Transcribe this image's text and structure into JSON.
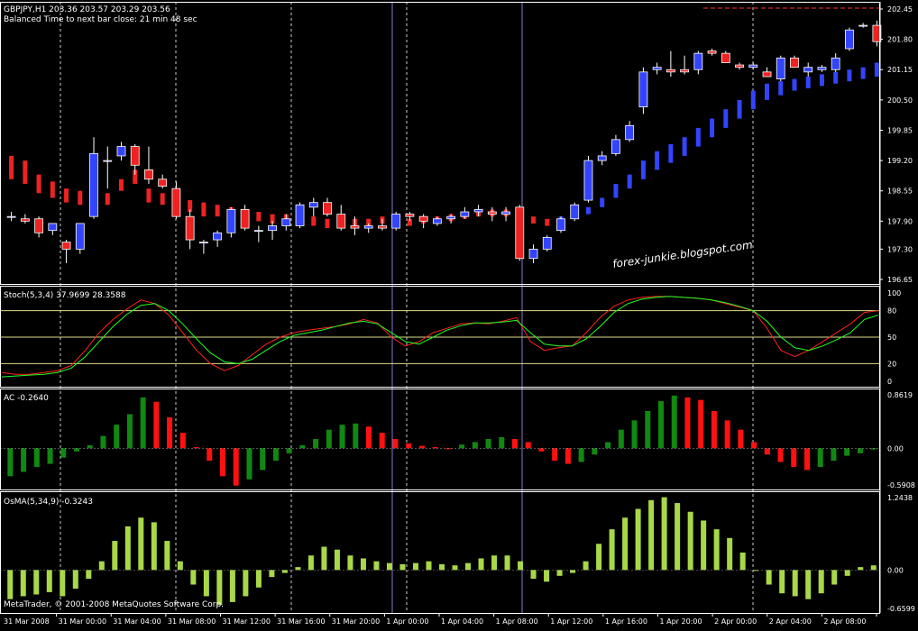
{
  "header": {
    "symbol_line": "GBPJPY,H1  203.36 203.57 203.29 203.56",
    "timer_line": "Balanced Time to next bar close: 21 min 48 sec"
  },
  "watermark": "forex-junkie.blogspot.com",
  "footer": "MetaTrader, © 2001-2008 MetaQuotes Software Corp.",
  "colors": {
    "background": "#000000",
    "axis": "#ffffff",
    "bull": "#3344ff",
    "bear": "#ee2222",
    "ac_up": "#118811",
    "ac_down": "#ff1111",
    "osma": "#a8d848",
    "stoch_main": "#ff2020",
    "stoch_signal": "#20ff20"
  },
  "chart_data": [
    {
      "type": "candlestick",
      "name": "price",
      "ylim": [
        196.65,
        202.45
      ],
      "y_ticks": [
        "202.45",
        "201.80",
        "201.15",
        "200.50",
        "199.85",
        "199.20",
        "198.55",
        "197.90",
        "197.30",
        "196.65"
      ],
      "candles": [
        [
          198.0,
          198.1,
          197.9,
          198.0
        ],
        [
          197.95,
          198.05,
          197.85,
          197.9
        ],
        [
          197.95,
          198.0,
          197.55,
          197.65
        ],
        [
          197.7,
          197.85,
          197.6,
          197.85
        ],
        [
          197.45,
          197.5,
          197.0,
          197.3
        ],
        [
          197.3,
          197.85,
          197.2,
          197.85
        ],
        [
          198.0,
          199.7,
          197.95,
          199.35
        ],
        [
          199.2,
          199.5,
          198.6,
          199.2
        ],
        [
          199.3,
          199.6,
          199.2,
          199.5
        ],
        [
          199.5,
          199.55,
          198.9,
          199.1
        ],
        [
          199.0,
          199.5,
          198.7,
          198.8
        ],
        [
          198.8,
          198.9,
          198.6,
          198.65
        ],
        [
          198.6,
          198.75,
          197.95,
          198.0
        ],
        [
          198.0,
          198.15,
          197.3,
          197.5
        ],
        [
          197.45,
          197.5,
          197.2,
          197.45
        ],
        [
          197.5,
          197.7,
          197.35,
          197.65
        ],
        [
          197.65,
          198.2,
          197.55,
          198.15
        ],
        [
          198.15,
          198.25,
          197.7,
          197.75
        ],
        [
          197.7,
          197.8,
          197.45,
          197.7
        ],
        [
          197.7,
          197.9,
          197.5,
          197.8
        ],
        [
          197.8,
          198.05,
          197.7,
          197.95
        ],
        [
          197.8,
          198.3,
          197.75,
          198.25
        ],
        [
          198.2,
          198.4,
          198.0,
          198.3
        ],
        [
          198.3,
          198.4,
          198.0,
          198.05
        ],
        [
          198.05,
          198.25,
          197.7,
          197.75
        ],
        [
          197.8,
          198.0,
          197.6,
          197.75
        ],
        [
          197.75,
          197.85,
          197.65,
          197.8
        ],
        [
          197.8,
          197.95,
          197.7,
          197.75
        ],
        [
          197.75,
          198.1,
          197.7,
          198.05
        ],
        [
          198.05,
          198.1,
          197.9,
          198.0
        ],
        [
          198.0,
          198.05,
          197.75,
          197.9
        ],
        [
          197.85,
          198.0,
          197.8,
          197.95
        ],
        [
          197.95,
          198.05,
          197.85,
          198.0
        ],
        [
          198.0,
          198.2,
          197.95,
          198.1
        ],
        [
          198.1,
          198.25,
          198.0,
          198.15
        ],
        [
          198.1,
          198.2,
          197.9,
          198.05
        ],
        [
          198.05,
          198.2,
          197.9,
          198.1
        ],
        [
          198.2,
          198.25,
          197.05,
          197.1
        ],
        [
          197.1,
          197.4,
          197.0,
          197.3
        ],
        [
          197.3,
          197.6,
          197.25,
          197.55
        ],
        [
          197.7,
          198.0,
          197.65,
          197.95
        ],
        [
          197.95,
          198.3,
          197.9,
          198.25
        ],
        [
          198.35,
          199.3,
          198.3,
          199.2
        ],
        [
          199.2,
          199.4,
          199.1,
          199.3
        ],
        [
          199.35,
          199.75,
          199.3,
          199.65
        ],
        [
          199.65,
          200.05,
          199.6,
          199.95
        ],
        [
          200.35,
          201.2,
          200.2,
          201.1
        ],
        [
          201.15,
          201.3,
          201.05,
          201.2
        ],
        [
          201.15,
          201.55,
          201.0,
          201.1
        ],
        [
          201.15,
          201.45,
          201.05,
          201.1
        ],
        [
          201.15,
          201.55,
          201.05,
          201.5
        ],
        [
          201.55,
          201.6,
          201.45,
          201.5
        ],
        [
          201.5,
          201.55,
          201.3,
          201.3
        ],
        [
          201.25,
          201.3,
          201.15,
          201.2
        ],
        [
          201.2,
          201.3,
          201.15,
          201.25
        ],
        [
          201.1,
          201.2,
          201.0,
          201.0
        ],
        [
          200.95,
          201.45,
          200.9,
          201.4
        ],
        [
          201.4,
          201.45,
          201.2,
          201.2
        ],
        [
          201.1,
          201.3,
          201.0,
          201.2
        ],
        [
          201.15,
          201.25,
          201.1,
          201.2
        ],
        [
          201.15,
          201.5,
          201.1,
          201.4
        ],
        [
          201.6,
          202.05,
          201.55,
          202.0
        ],
        [
          202.1,
          202.15,
          202.05,
          202.1
        ],
        [
          202.1,
          202.2,
          201.65,
          201.75
        ]
      ],
      "overlay_arrows": [
        [
          198.8,
          199.3
        ],
        [
          198.7,
          199.2
        ],
        [
          198.5,
          198.9
        ],
        [
          198.4,
          198.75
        ],
        [
          198.3,
          198.6
        ],
        [
          198.25,
          198.55
        ],
        [
          198.35,
          198.6
        ],
        [
          198.25,
          198.5
        ],
        [
          198.55,
          198.8
        ],
        [
          198.7,
          199.0
        ],
        [
          198.3,
          198.6
        ],
        [
          198.25,
          198.5
        ],
        [
          198.15,
          198.4
        ],
        [
          198.1,
          198.35
        ],
        [
          198.0,
          198.3
        ],
        [
          198.0,
          198.25
        ],
        [
          197.95,
          198.2
        ],
        [
          197.95,
          198.15
        ],
        [
          197.9,
          198.1
        ],
        [
          197.85,
          198.05
        ],
        [
          197.85,
          198.05
        ],
        [
          197.8,
          198.0
        ],
        [
          197.8,
          198.0
        ],
        [
          197.75,
          197.95
        ],
        [
          197.85,
          198.0
        ],
        [
          197.8,
          197.95
        ],
        [
          197.8,
          197.95
        ],
        [
          197.85,
          198.0
        ],
        [
          197.85,
          198.0
        ],
        [
          197.8,
          197.95
        ],
        [
          197.85,
          198.0
        ],
        [
          197.9,
          198.0
        ],
        [
          197.9,
          198.05
        ],
        [
          197.95,
          198.1
        ],
        [
          198.0,
          198.15
        ],
        [
          198.0,
          198.15
        ],
        [
          198.0,
          198.15
        ],
        [
          198.05,
          198.2
        ],
        [
          197.85,
          198.0
        ],
        [
          197.8,
          197.95
        ],
        [
          197.85,
          198.0
        ],
        [
          197.95,
          198.1
        ],
        [
          198.05,
          198.2
        ],
        [
          198.2,
          198.4
        ],
        [
          198.4,
          198.7
        ],
        [
          198.6,
          198.9
        ],
        [
          198.8,
          199.2
        ],
        [
          199.0,
          199.4
        ],
        [
          199.15,
          199.55
        ],
        [
          199.3,
          199.7
        ],
        [
          199.5,
          199.9
        ],
        [
          199.7,
          200.1
        ],
        [
          199.9,
          200.3
        ],
        [
          200.1,
          200.5
        ],
        [
          200.3,
          200.7
        ],
        [
          200.5,
          200.85
        ],
        [
          200.6,
          200.9
        ],
        [
          200.7,
          200.95
        ],
        [
          200.75,
          201.0
        ],
        [
          200.8,
          201.05
        ],
        [
          200.85,
          201.1
        ],
        [
          200.9,
          201.15
        ],
        [
          200.95,
          201.2
        ],
        [
          201.0,
          201.3
        ]
      ]
    },
    {
      "type": "line",
      "title": "Stoch(5,3,4) 37.9699 28.3588",
      "ylim": [
        0,
        100
      ],
      "levels": [
        20,
        50,
        80
      ],
      "y_ticks": [
        "100",
        "80",
        "50",
        "20",
        "0"
      ],
      "series": [
        {
          "values": [
            10,
            8,
            8,
            10,
            12,
            18,
            35,
            55,
            70,
            82,
            92,
            88,
            75,
            55,
            35,
            20,
            12,
            18,
            30,
            42,
            50,
            55,
            58,
            60,
            62,
            65,
            70,
            66,
            50,
            40,
            45,
            55,
            60,
            65,
            66,
            65,
            68,
            72,
            45,
            35,
            38,
            40,
            55,
            72,
            85,
            92,
            95,
            96,
            96,
            95,
            94,
            92,
            88,
            84,
            80,
            60,
            35,
            28,
            35,
            45,
            55,
            65,
            78,
            80
          ]
        },
        {
          "values": [
            5,
            6,
            7,
            8,
            10,
            15,
            28,
            45,
            62,
            76,
            86,
            88,
            80,
            65,
            48,
            32,
            22,
            20,
            25,
            35,
            45,
            52,
            55,
            58,
            62,
            66,
            68,
            65,
            55,
            45,
            42,
            50,
            58,
            63,
            66,
            66,
            67,
            69,
            55,
            42,
            40,
            40,
            48,
            62,
            78,
            88,
            93,
            95,
            96,
            95,
            94,
            92,
            89,
            85,
            80,
            68,
            50,
            38,
            35,
            40,
            47,
            55,
            70,
            75
          ]
        }
      ]
    },
    {
      "type": "bar",
      "title": "AC -0.2640",
      "ylim": [
        -0.5908,
        0.8619
      ],
      "y_ticks": [
        "0.8619",
        "0.00",
        "-0.5908"
      ],
      "values": [
        -0.45,
        -0.38,
        -0.3,
        -0.25,
        -0.15,
        -0.05,
        0.05,
        0.2,
        0.38,
        0.55,
        0.82,
        0.75,
        0.5,
        0.25,
        0.02,
        -0.2,
        -0.45,
        -0.6,
        -0.5,
        -0.35,
        -0.2,
        -0.08,
        0.05,
        0.15,
        0.3,
        0.38,
        0.4,
        0.35,
        0.25,
        0.15,
        0.08,
        0.04,
        0.02,
        0.0,
        0.06,
        0.1,
        0.15,
        0.18,
        0.15,
        0.1,
        -0.05,
        -0.2,
        -0.25,
        -0.22,
        -0.1,
        0.1,
        0.3,
        0.45,
        0.6,
        0.76,
        0.85,
        0.82,
        0.78,
        0.6,
        0.45,
        0.3,
        0.1,
        -0.1,
        -0.22,
        -0.3,
        -0.35,
        -0.3,
        -0.2,
        -0.12,
        -0.08,
        -0.02
      ]
    },
    {
      "type": "bar",
      "title": "OsMA(5,34,9) -0.3243",
      "ylim": [
        -0.6599,
        1.2438
      ],
      "y_ticks": [
        "1.2438",
        "0.00",
        "-0.6599"
      ],
      "values": [
        -0.5,
        -0.45,
        -0.42,
        -0.38,
        -0.45,
        -0.32,
        -0.15,
        0.15,
        0.5,
        0.75,
        0.9,
        0.82,
        0.5,
        0.15,
        -0.25,
        -0.45,
        -0.6,
        -0.55,
        -0.45,
        -0.3,
        -0.12,
        -0.05,
        0.05,
        0.25,
        0.4,
        0.35,
        0.25,
        0.2,
        0.15,
        0.12,
        0.1,
        0.12,
        0.15,
        0.1,
        0.08,
        0.12,
        0.2,
        0.25,
        0.25,
        0.15,
        -0.15,
        -0.2,
        -0.1,
        -0.05,
        0.15,
        0.45,
        0.7,
        0.9,
        1.05,
        1.2,
        1.25,
        1.15,
        1.0,
        0.85,
        0.7,
        0.55,
        0.3,
        0.0,
        -0.25,
        -0.4,
        -0.45,
        -0.5,
        -0.4,
        -0.25,
        -0.1,
        0.05,
        0.08
      ]
    }
  ],
  "time_labels": [
    "31 Mar 2008",
    "31 Mar 00:00",
    "31 Mar 04:00",
    "31 Mar 08:00",
    "31 Mar 12:00",
    "31 Mar 16:00",
    "31 Mar 20:00",
    "1 Apr 00:00",
    "1 Apr 04:00",
    "1 Apr 08:00",
    "1 Apr 12:00",
    "1 Apr 16:00",
    "1 Apr 20:00",
    "2 Apr 00:00",
    "2 Apr 04:00",
    "2 Apr 08:00"
  ]
}
